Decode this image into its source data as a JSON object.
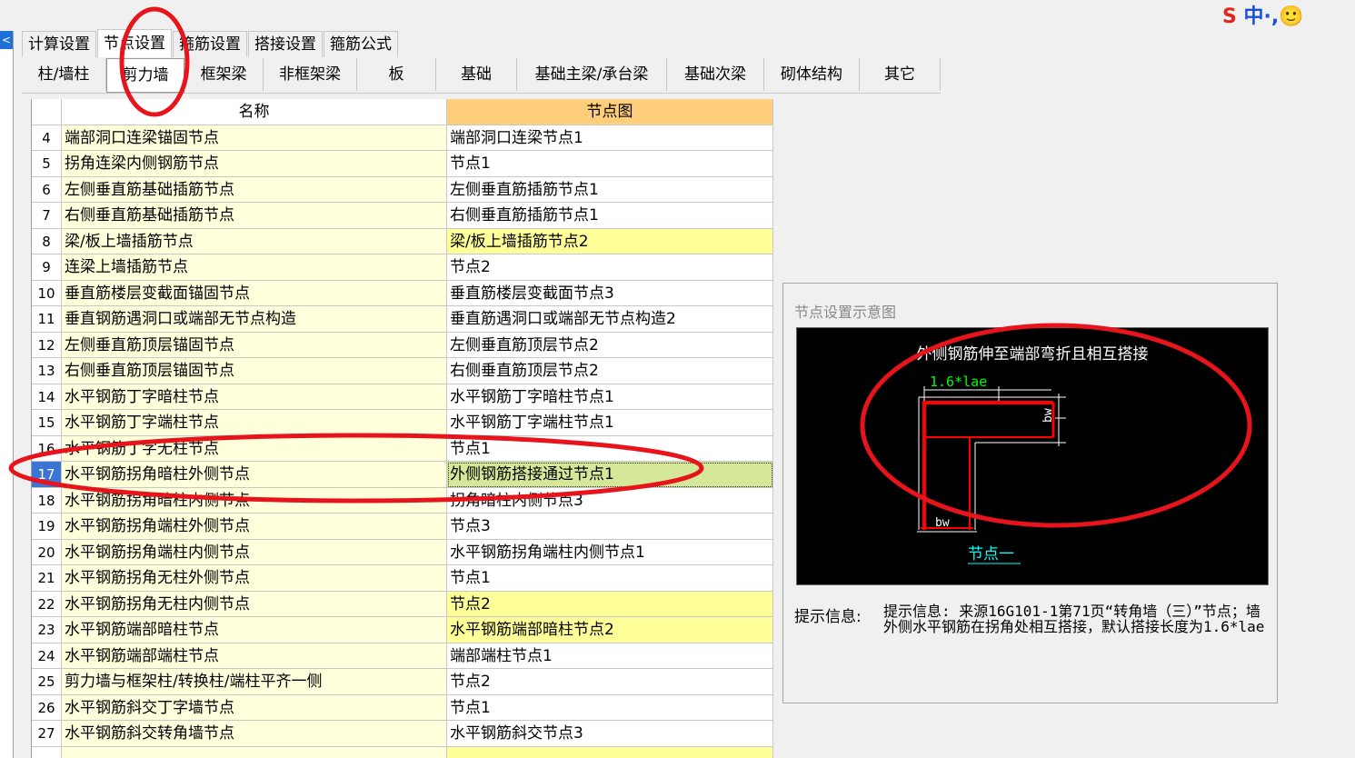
{
  "ime": {
    "logo_letter": "S",
    "text": "中·,🙂"
  },
  "top_tabs": [
    "计算设置",
    "节点设置",
    "箍筋设置",
    "搭接设置",
    "箍筋公式"
  ],
  "sub_tabs": [
    "柱/墙柱",
    "剪力墙",
    "框架梁",
    "非框架梁",
    "板",
    "基础",
    "基础主梁/承台梁",
    "基础次梁",
    "砌体结构",
    "其它"
  ],
  "grid": {
    "header_name": "名称",
    "header_node": "节点图",
    "rows": [
      {
        "num": "4",
        "name": "端部洞口连梁锚固节点",
        "node": "端部洞口连梁节点1"
      },
      {
        "num": "5",
        "name": "拐角连梁内侧钢筋节点",
        "node": "节点1"
      },
      {
        "num": "6",
        "name": "左侧垂直筋基础插筋节点",
        "node": "左侧垂直筋插筋节点1"
      },
      {
        "num": "7",
        "name": "右侧垂直筋基础插筋节点",
        "node": "右侧垂直筋插筋节点1"
      },
      {
        "num": "8",
        "name": "梁/板上墙插筋节点",
        "node": "梁/板上墙插筋节点2"
      },
      {
        "num": "9",
        "name": "连梁上墙插筋节点",
        "node": "节点2"
      },
      {
        "num": "10",
        "name": "垂直筋楼层变截面锚固节点",
        "node": "垂直筋楼层变截面节点3"
      },
      {
        "num": "11",
        "name": "垂直钢筋遇洞口或端部无节点构造",
        "node": "垂直筋遇洞口或端部无节点构造2"
      },
      {
        "num": "12",
        "name": "左侧垂直筋顶层锚固节点",
        "node": "左侧垂直筋顶层节点2"
      },
      {
        "num": "13",
        "name": "右侧垂直筋顶层锚固节点",
        "node": "右侧垂直筋顶层节点2"
      },
      {
        "num": "14",
        "name": "水平钢筋丁字暗柱节点",
        "node": "水平钢筋丁字暗柱节点1"
      },
      {
        "num": "15",
        "name": "水平钢筋丁字端柱节点",
        "node": "水平钢筋丁字端柱节点1"
      },
      {
        "num": "16",
        "name": "水平钢筋丁字无柱节点",
        "node": "节点1"
      },
      {
        "num": "17",
        "name": "水平钢筋拐角暗柱外侧节点",
        "node": "外侧钢筋搭接通过节点1"
      },
      {
        "num": "18",
        "name": "水平钢筋拐角暗柱内侧节点",
        "node": "拐角暗柱内侧节点3"
      },
      {
        "num": "19",
        "name": "水平钢筋拐角端柱外侧节点",
        "node": "节点3"
      },
      {
        "num": "20",
        "name": "水平钢筋拐角端柱内侧节点",
        "node": "水平钢筋拐角端柱内侧节点1"
      },
      {
        "num": "21",
        "name": "水平钢筋拐角无柱外侧节点",
        "node": "节点1"
      },
      {
        "num": "22",
        "name": "水平钢筋拐角无柱内侧节点",
        "node": "节点2"
      },
      {
        "num": "23",
        "name": "水平钢筋端部暗柱节点",
        "node": "水平钢筋端部暗柱节点2"
      },
      {
        "num": "24",
        "name": "水平钢筋端部端柱节点",
        "node": "端部端柱节点1"
      },
      {
        "num": "25",
        "name": "剪力墙与框架柱/转换柱/端柱平齐一侧",
        "node": "节点2"
      },
      {
        "num": "26",
        "name": "水平钢筋斜交丁字墙节点",
        "node": "节点1"
      },
      {
        "num": "27",
        "name": "水平钢筋斜交转角墙节点",
        "node": "水平钢筋斜交节点3"
      }
    ]
  },
  "preview": {
    "title": "节点设置示意图",
    "drawing_caption": "外侧钢筋伸至端部弯折且相互搭接",
    "dim_lap": "1.6*lae",
    "dim_bw_right": "bw",
    "dim_bw_bottom": "bw",
    "node_link": "节点一",
    "tip_label": "提示信息:",
    "tip_text": "提示信息: 来源16G101-1第71页“转角墙（三）”节点；墙外侧水平钢筋在拐角处相互搭接，默认搭接长度为1.6*lae"
  },
  "colors": {
    "selected_row_number_bg": "#3a75d4",
    "header_node_bg": "#ffce7a",
    "highlight_cell_bg": "#ffff99",
    "annotation_red": "#e8141c",
    "rebar_red": "#ff0000",
    "dim_green": "#00ff00",
    "link_cyan": "#00ffff"
  }
}
